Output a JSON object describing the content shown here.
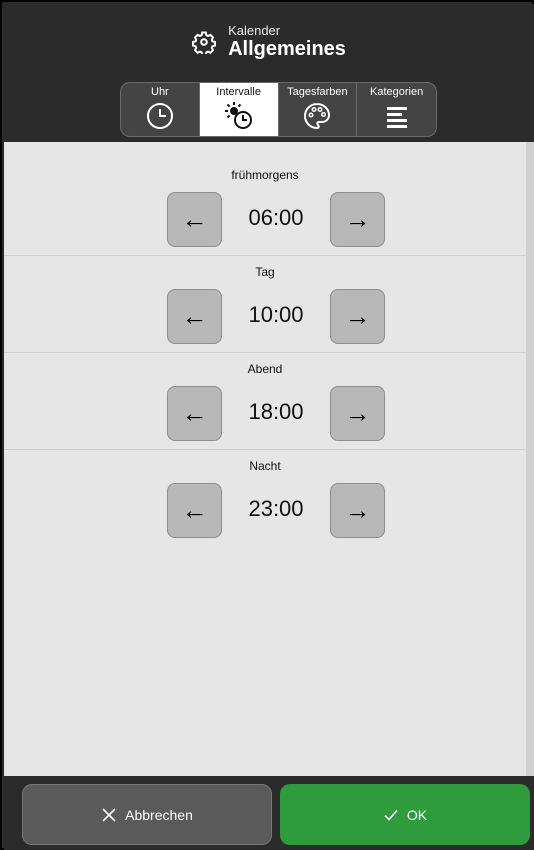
{
  "header": {
    "subtitle": "Kalender",
    "title": "Allgemeines",
    "icon": "gear-icon"
  },
  "tabs": [
    {
      "label": "Uhr",
      "icon": "clock-icon",
      "active": false
    },
    {
      "label": "Intervalle",
      "icon": "sun-clock-icon",
      "active": true
    },
    {
      "label": "Tagesfarben",
      "icon": "palette-icon",
      "active": false
    },
    {
      "label": "Kategorien",
      "icon": "list-lines-icon",
      "active": false
    }
  ],
  "intervals": [
    {
      "label": "frühmorgens",
      "time": "06:00",
      "prev_arrow": "←",
      "next_arrow": "→"
    },
    {
      "label": "Tag",
      "time": "10:00",
      "prev_arrow": "←",
      "next_arrow": "→"
    },
    {
      "label": "Abend",
      "time": "18:00",
      "prev_arrow": "←",
      "next_arrow": "→"
    },
    {
      "label": "Nacht",
      "time": "23:00",
      "prev_arrow": "←",
      "next_arrow": "→"
    }
  ],
  "footer": {
    "cancel_label": "Abbrechen",
    "ok_label": "OK"
  },
  "colors": {
    "header_bg": "#2b2b2b",
    "content_bg": "#e6e6e6",
    "ok_green": "#2e9b3c",
    "button_gray": "#b8b8b8"
  }
}
